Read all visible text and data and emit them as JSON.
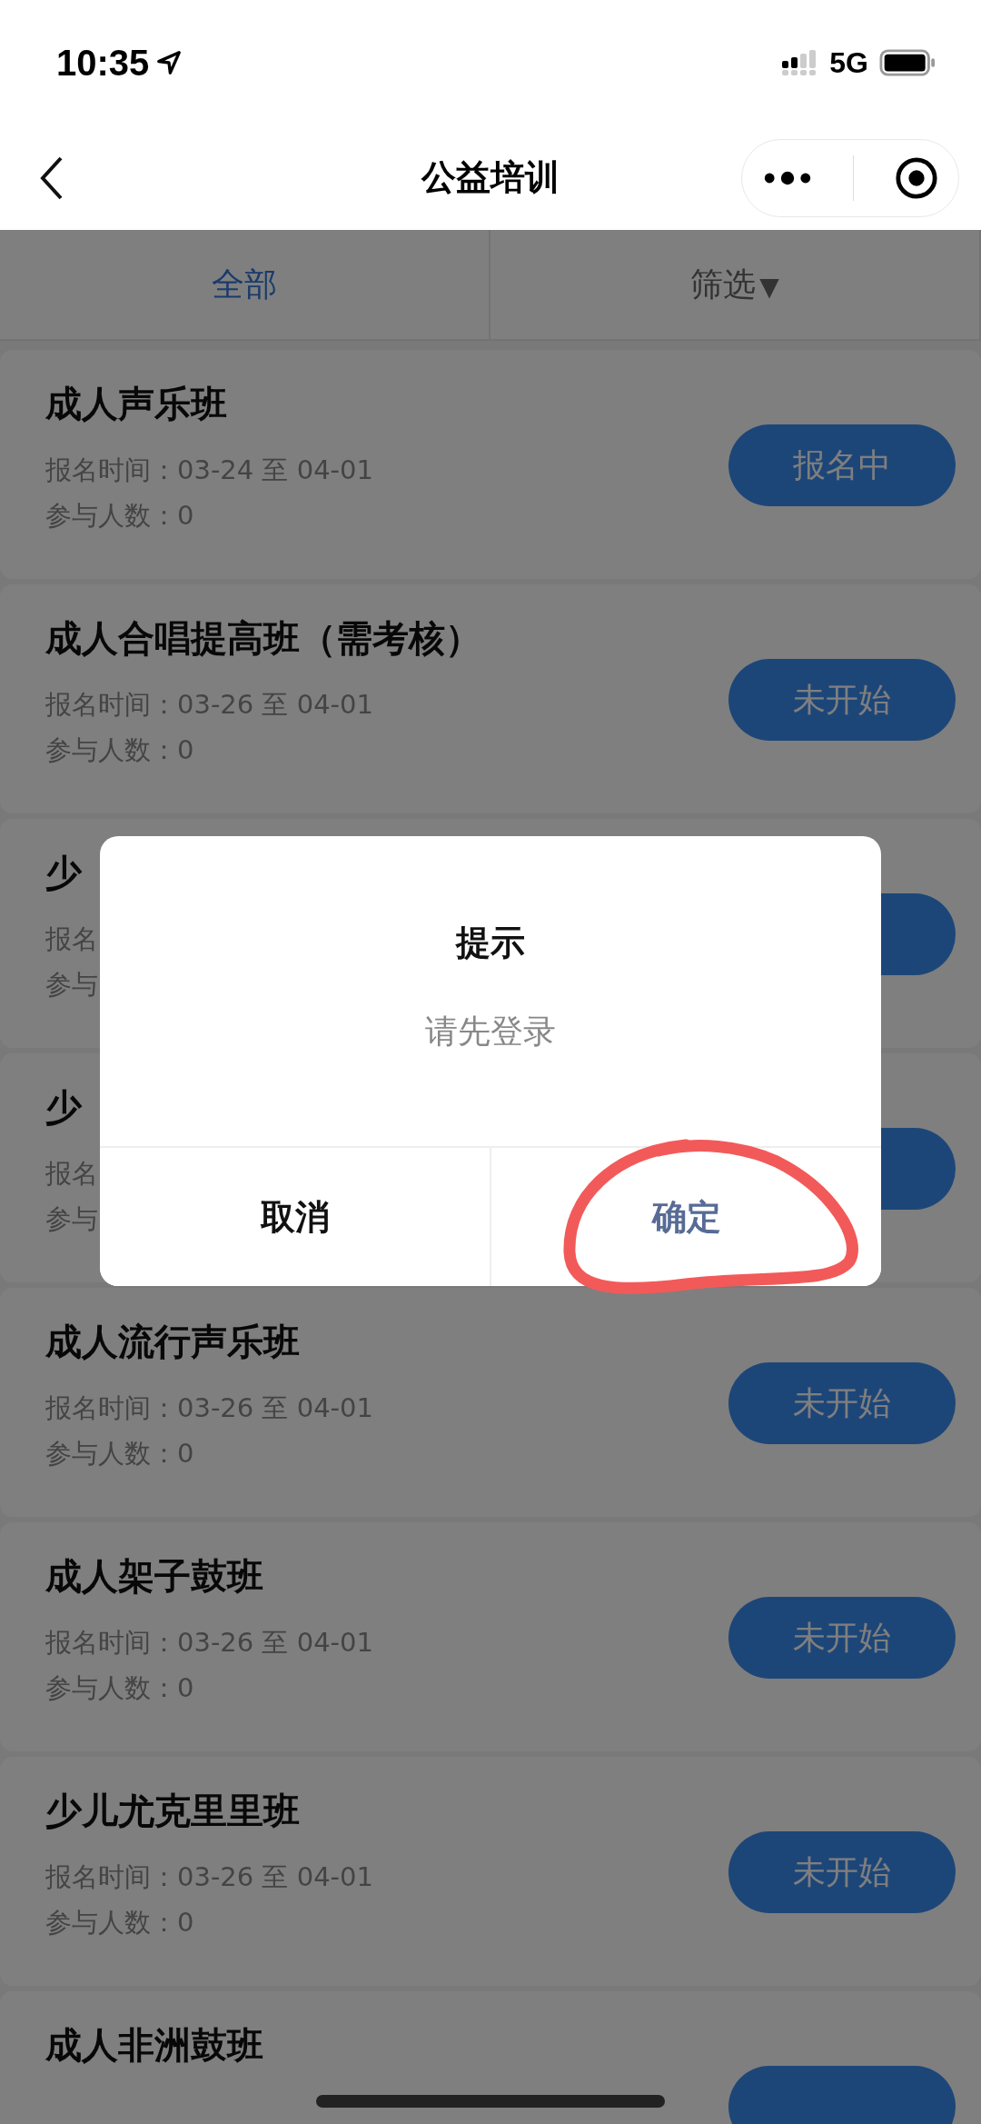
{
  "status_bar": {
    "time": "10:35",
    "network": "5G"
  },
  "nav": {
    "title": "公益培训"
  },
  "tabs": [
    {
      "label": "全部",
      "selected": true
    },
    {
      "label": "筛选",
      "caret": "▼",
      "selected": false
    }
  ],
  "courses": [
    {
      "title": "成人声乐班",
      "period": "报名时间：03-24 至 04-01",
      "participants": "参与人数：0",
      "status": "报名中"
    },
    {
      "title": "成人合唱提高班（需考核）",
      "period": "报名时间：03-26 至 04-01",
      "participants": "参与人数：0",
      "status": "未开始"
    },
    {
      "title": "少",
      "period": "报名",
      "participants": "参与"
    },
    {
      "title": "少",
      "period": "报名",
      "participants": "参与"
    },
    {
      "title": "成人流行声乐班",
      "period": "报名时间：03-26 至 04-01",
      "participants": "参与人数：0",
      "status": "未开始"
    },
    {
      "title": "成人架子鼓班",
      "period": "报名时间：03-26 至 04-01",
      "participants": "参与人数：0",
      "status": "未开始"
    },
    {
      "title": "少儿尤克里里班",
      "period": "报名时间：03-26 至 04-01",
      "participants": "参与人数：0",
      "status": "未开始"
    },
    {
      "title": "成人非洲鼓班"
    }
  ],
  "dialog": {
    "title": "提示",
    "message": "请先登录",
    "buttons": [
      {
        "label": "取消",
        "kind": "cancel"
      },
      {
        "label": "确定",
        "kind": "confirm"
      }
    ]
  }
}
